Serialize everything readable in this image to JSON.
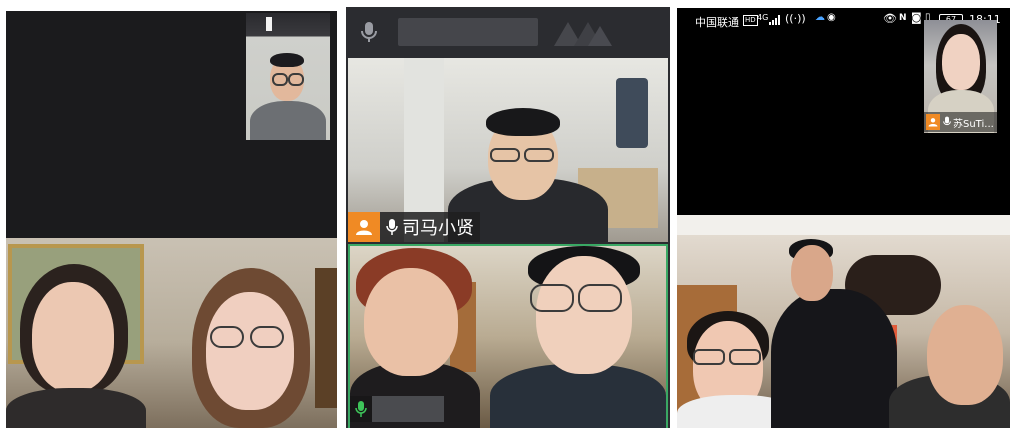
{
  "left_panel": {
    "note": ""
  },
  "middle_panel": {
    "active_speaker": {
      "name": "司马小贤"
    },
    "lower_tile": {
      "name": ""
    }
  },
  "right_panel": {
    "status_bar": {
      "carrier": "中国联通",
      "network_badge": "HD",
      "signal": "4G",
      "battery": "67",
      "time": "18:11"
    },
    "self_view": {
      "name": "苏SuTi..."
    }
  },
  "colors": {
    "dark_bg": "#1b1b1d",
    "toolbar_bg": "#2b2c30",
    "active_border": "#3aa864",
    "orange_badge": "#f08a24"
  }
}
